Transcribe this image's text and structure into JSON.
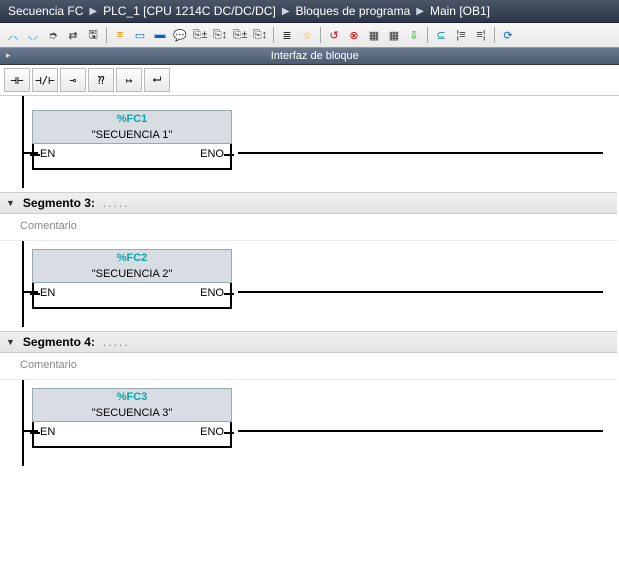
{
  "breadcrumb": {
    "p0": "Secuencia FC",
    "p1": "PLC_1 [CPU 1214C DC/DC/DC]",
    "p2": "Bloques de programa",
    "p3": "Main [OB1]"
  },
  "interface_label": "Interfaz de bloque",
  "ladder_symbols": {
    "s0": "⊣⊢",
    "s1": "⊣/⊢",
    "s2": "⊸",
    "s3": "⁇",
    "s4": "↦",
    "s5": "⮠"
  },
  "networks": [
    {
      "has_header": false,
      "seg_title": "",
      "comment": "",
      "fc_addr": "%FC1",
      "fc_name": "\"SECUENCIA 1\"",
      "en": "EN",
      "eno": "ENO"
    },
    {
      "has_header": true,
      "seg_title": "Segmento 3:",
      "comment": "Comentario",
      "fc_addr": "%FC2",
      "fc_name": "\"SECUENCIA 2\"",
      "en": "EN",
      "eno": "ENO"
    },
    {
      "has_header": true,
      "seg_title": "Segmento 4:",
      "comment": "Comentario",
      "fc_addr": "%FC3",
      "fc_name": "\"SECUENCIA 3\"",
      "en": "EN",
      "eno": "ENO"
    }
  ]
}
